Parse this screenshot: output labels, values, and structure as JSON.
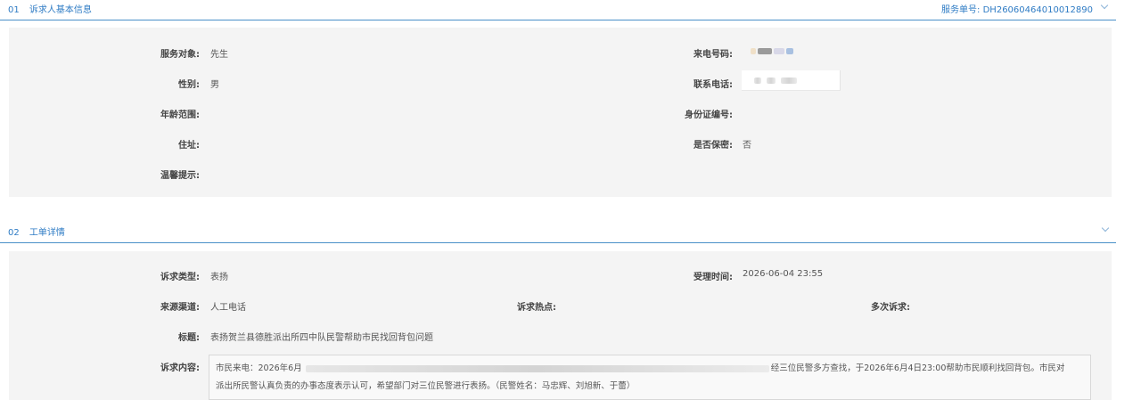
{
  "section1": {
    "number": "01",
    "title": "诉求人基本信息",
    "service_no_label": "服务单号:",
    "service_no": "DH26060464010012890"
  },
  "basic": {
    "service_target_label": "服务对象:",
    "service_target": "先生",
    "incoming_phone_label": "来电号码:",
    "gender_label": "性别:",
    "gender": "男",
    "contact_phone_label": "联系电话:",
    "age_label": "年龄范围:",
    "id_label": "身份证编号:",
    "address_label": "住址:",
    "confidential_label": "是否保密:",
    "confidential": "否",
    "tip_label": "温馨提示:"
  },
  "section2": {
    "number": "02",
    "title": "工单详情"
  },
  "detail": {
    "type_label": "诉求类型:",
    "type": "表扬",
    "accept_time_label": "受理时间:",
    "accept_time": "2026-06-04 23:55",
    "channel_label": "来源渠道:",
    "channel": "人工电话",
    "hotspot_label": "诉求热点:",
    "multi_label": "多次诉求:",
    "subject_label": "标题:",
    "subject": "表扬贺兰县德胜派出所四中队民警帮助市民找回背包问题",
    "content_label": "诉求内容:",
    "content_line1_start": "市民来电：2026年6月",
    "content_line1_end": "经三位民警多方查找，于2026年6月4日23:00帮助市民顺利找回背包。市民对",
    "content_line2": "派出所民警认真负责的办事态度表示认可，希望部门对三位民警进行表扬。（民警姓名：马忠辉、刘旭新、于蕾）"
  }
}
